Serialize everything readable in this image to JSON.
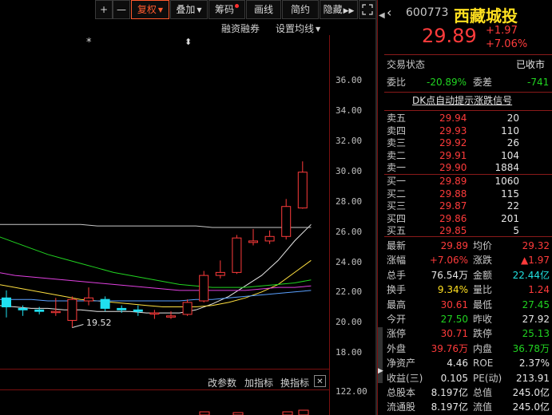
{
  "toolbar": {
    "plus": "+",
    "minus": "—",
    "fuquan": "复权",
    "diejia": "叠加",
    "chouma": "筹码",
    "huaxian": "画线",
    "jianyue": "简约",
    "yincang": "隐藏",
    "expand": "⛶"
  },
  "chart": {
    "rzrq": "融资融券",
    "ma_setting": "设置均线",
    "markers": [
      "*",
      "⬍"
    ],
    "y_ticks": [
      "36.00",
      "34.00",
      "32.00",
      "30.00",
      "28.00",
      "26.00",
      "24.00",
      "22.00",
      "20.00",
      "18.00"
    ],
    "low_label": "19.52",
    "bottom_links": [
      "改参数",
      "加指标",
      "换指标"
    ],
    "volume_tick": "122.00",
    "close_btn": "✕"
  },
  "quote": {
    "code": "600773",
    "name": "西藏城投",
    "price": "29.89",
    "change": "+1.97",
    "change_pct": "+7.06%",
    "status_label": "交易状态",
    "status_value": "已收市",
    "weibi_label": "委比",
    "weibi_value": "-20.89%",
    "weicha_label": "委差",
    "weicha_value": "-741",
    "dk_signal": "DK点自动提示涨跌信号"
  },
  "asks": [
    {
      "label": "卖五",
      "price": "29.94",
      "vol": "20"
    },
    {
      "label": "卖四",
      "price": "29.93",
      "vol": "110"
    },
    {
      "label": "卖三",
      "price": "29.92",
      "vol": "26"
    },
    {
      "label": "卖二",
      "price": "29.91",
      "vol": "104"
    },
    {
      "label": "卖一",
      "price": "29.90",
      "vol": "1884"
    }
  ],
  "bids": [
    {
      "label": "买一",
      "price": "29.89",
      "vol": "1060"
    },
    {
      "label": "买二",
      "price": "29.88",
      "vol": "115"
    },
    {
      "label": "买三",
      "price": "29.87",
      "vol": "22"
    },
    {
      "label": "买四",
      "price": "29.86",
      "vol": "201"
    },
    {
      "label": "买五",
      "price": "29.85",
      "vol": "5"
    }
  ],
  "stats": [
    {
      "l1": "最新",
      "v1": "29.89",
      "c1": "red",
      "l2": "均价",
      "v2": "29.32",
      "c2": "red"
    },
    {
      "l1": "涨幅",
      "v1": "+7.06%",
      "c1": "red",
      "l2": "涨跌",
      "v2": "▲1.97",
      "c2": "red"
    },
    {
      "l1": "总手",
      "v1": "76.54万",
      "c1": "white",
      "l2": "金额",
      "v2": "22.44亿",
      "c2": "cyan"
    },
    {
      "l1": "换手",
      "v1": "9.34%",
      "c1": "yellow",
      "l2": "量比",
      "v2": "1.24",
      "c2": "red"
    },
    {
      "l1": "最高",
      "v1": "30.61",
      "c1": "red",
      "l2": "最低",
      "v2": "27.45",
      "c2": "green"
    },
    {
      "l1": "今开",
      "v1": "27.50",
      "c1": "green",
      "l2": "昨收",
      "v2": "27.92",
      "c2": "white"
    },
    {
      "l1": "涨停",
      "v1": "30.71",
      "c1": "red",
      "l2": "跌停",
      "v2": "25.13",
      "c2": "green"
    },
    {
      "l1": "外盘",
      "v1": "39.76万",
      "c1": "red",
      "l2": "内盘",
      "v2": "36.78万",
      "c2": "green"
    },
    {
      "l1": "净资产",
      "v1": "4.46",
      "c1": "white",
      "l2": "ROE",
      "v2": "2.37%",
      "c2": "white"
    },
    {
      "l1": "收益(三)",
      "v1": "0.105",
      "c1": "white",
      "l2": "PE(动)",
      "v2": "213.91",
      "c2": "white"
    },
    {
      "l1": "总股本",
      "v1": "8.197亿",
      "c1": "white",
      "l2": "总值",
      "v2": "245.0亿",
      "c2": "white"
    },
    {
      "l1": "流通股",
      "v1": "8.197亿",
      "c1": "white",
      "l2": "流值",
      "v2": "245.0亿",
      "c2": "white"
    }
  ],
  "chart_data": {
    "type": "candlestick",
    "y_range": [
      18,
      36
    ],
    "candles": [
      {
        "o": 21.5,
        "c": 20.9,
        "h": 22.0,
        "l": 20.2
      },
      {
        "o": 20.8,
        "c": 20.7,
        "h": 21.0,
        "l": 20.3
      },
      {
        "o": 20.7,
        "c": 20.6,
        "h": 20.9,
        "l": 20.4
      },
      {
        "o": 20.6,
        "c": 20.6,
        "h": 21.5,
        "l": 20.3
      },
      {
        "o": 20.0,
        "c": 21.4,
        "h": 21.6,
        "l": 19.52
      },
      {
        "o": 21.3,
        "c": 21.5,
        "h": 22.2,
        "l": 21.0
      },
      {
        "o": 21.4,
        "c": 20.8,
        "h": 21.6,
        "l": 20.6
      },
      {
        "o": 20.8,
        "c": 20.7,
        "h": 21.0,
        "l": 20.5
      },
      {
        "o": 20.7,
        "c": 20.6,
        "h": 21.0,
        "l": 20.3
      },
      {
        "o": 20.5,
        "c": 20.5,
        "h": 20.7,
        "l": 20.1
      },
      {
        "o": 20.3,
        "c": 20.3,
        "h": 20.6,
        "l": 20.1
      },
      {
        "o": 20.4,
        "c": 21.2,
        "h": 21.4,
        "l": 20.3
      },
      {
        "o": 21.3,
        "c": 23.0,
        "h": 23.3,
        "l": 21.2
      },
      {
        "o": 23.0,
        "c": 23.2,
        "h": 24.0,
        "l": 22.8
      },
      {
        "o": 23.2,
        "c": 25.5,
        "h": 25.7,
        "l": 23.1
      },
      {
        "o": 25.2,
        "c": 25.3,
        "h": 26.1,
        "l": 25.0
      },
      {
        "o": 25.3,
        "c": 25.6,
        "h": 26.0,
        "l": 25.1
      },
      {
        "o": 25.6,
        "c": 27.6,
        "h": 28.1,
        "l": 25.4
      },
      {
        "o": 27.5,
        "c": 29.89,
        "h": 30.61,
        "l": 27.45
      }
    ],
    "ma_lines": [
      {
        "color": "#e6e6e6",
        "values": [
          21.0,
          20.9,
          20.8,
          20.8,
          20.7,
          20.7,
          20.6,
          20.6,
          20.6,
          20.5,
          20.5,
          20.5,
          20.7,
          21.1,
          21.6,
          22.3,
          23.0,
          24.0,
          25.3,
          26.4
        ]
      },
      {
        "color": "#ffe040",
        "values": [
          22.4,
          22.2,
          22.0,
          21.8,
          21.6,
          21.4,
          21.3,
          21.2,
          21.1,
          21.0,
          20.9,
          20.9,
          20.9,
          21.0,
          21.2,
          21.5,
          21.9,
          22.4,
          23.2,
          24.0
        ]
      },
      {
        "color": "#21d421",
        "values": [
          25.6,
          25.2,
          24.8,
          24.4,
          24.1,
          23.8,
          23.5,
          23.2,
          23.0,
          22.8,
          22.6,
          22.4,
          22.3,
          22.2,
          22.2,
          22.2,
          22.3,
          22.4,
          22.5,
          22.7
        ]
      },
      {
        "color": "#e040e0",
        "values": [
          23.2,
          23.0,
          22.9,
          22.8,
          22.7,
          22.6,
          22.5,
          22.4,
          22.3,
          22.2,
          22.1,
          22.0,
          22.0,
          22.0,
          22.0,
          22.0,
          22.1,
          22.2,
          22.2,
          22.3
        ]
      },
      {
        "color": "#5aa0ff",
        "values": [
          21.4,
          21.4,
          21.4,
          21.3,
          21.3,
          21.3,
          21.3,
          21.3,
          21.3,
          21.3,
          21.3,
          21.3,
          21.4,
          21.4,
          21.5,
          21.6,
          21.7,
          21.8,
          21.9,
          22.0
        ]
      },
      {
        "color": "#c8c8c8",
        "values": [
          26.4,
          26.4,
          26.4,
          26.4,
          26.4,
          26.4,
          26.3,
          26.3,
          26.3,
          26.3,
          26.3,
          26.3,
          26.3,
          26.2,
          26.2,
          26.2,
          26.2,
          26.2,
          26.2,
          26.2
        ]
      }
    ]
  }
}
